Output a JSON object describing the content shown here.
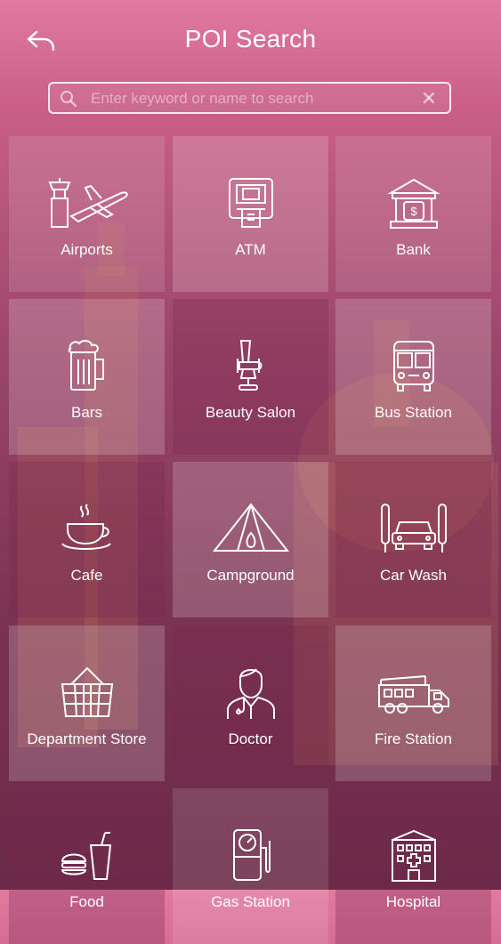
{
  "header": {
    "title": "POI Search"
  },
  "search": {
    "placeholder": "Enter keyword or name to search",
    "value": ""
  },
  "tiles": [
    {
      "label": "Airports",
      "icon": "airport-icon"
    },
    {
      "label": "ATM",
      "icon": "atm-icon"
    },
    {
      "label": "Bank",
      "icon": "bank-icon"
    },
    {
      "label": "Bars",
      "icon": "beer-mug-icon"
    },
    {
      "label": "Beauty Salon",
      "icon": "salon-chair-icon"
    },
    {
      "label": "Bus Station",
      "icon": "bus-icon"
    },
    {
      "label": "Cafe",
      "icon": "coffee-cup-icon"
    },
    {
      "label": "Campground",
      "icon": "tent-icon"
    },
    {
      "label": "Car Wash",
      "icon": "car-wash-icon"
    },
    {
      "label": "Department Store",
      "icon": "basket-icon"
    },
    {
      "label": "Doctor",
      "icon": "doctor-icon"
    },
    {
      "label": "Fire Station",
      "icon": "fire-truck-icon"
    },
    {
      "label": "Food",
      "icon": "fast-food-icon"
    },
    {
      "label": "Gas Station",
      "icon": "gas-pump-icon"
    },
    {
      "label": "Hospital",
      "icon": "hospital-icon"
    }
  ]
}
